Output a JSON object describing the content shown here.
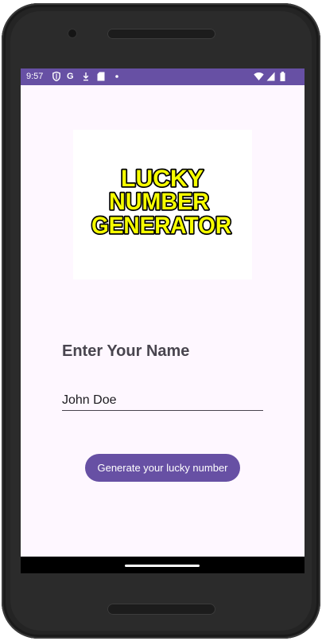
{
  "status_bar": {
    "time": "9:57",
    "left_icons": [
      "shield-icon",
      "google-g-icon",
      "download-icon",
      "sd-card-icon",
      "dot-icon"
    ],
    "right_icons": [
      "wifi-icon",
      "signal-icon",
      "battery-icon"
    ],
    "color": "#6750a4"
  },
  "logo": {
    "lines": [
      "LUCKY",
      "NUMBER",
      "GENERATOR"
    ],
    "fill_color": "#f6ff00",
    "outline_color": "#000000"
  },
  "form": {
    "label": "Enter Your Name",
    "name_value": "John Doe"
  },
  "button": {
    "label": "Generate your lucky number",
    "color": "#6750a4"
  },
  "colors": {
    "background": "#fef7ff",
    "text": "#49454f"
  }
}
